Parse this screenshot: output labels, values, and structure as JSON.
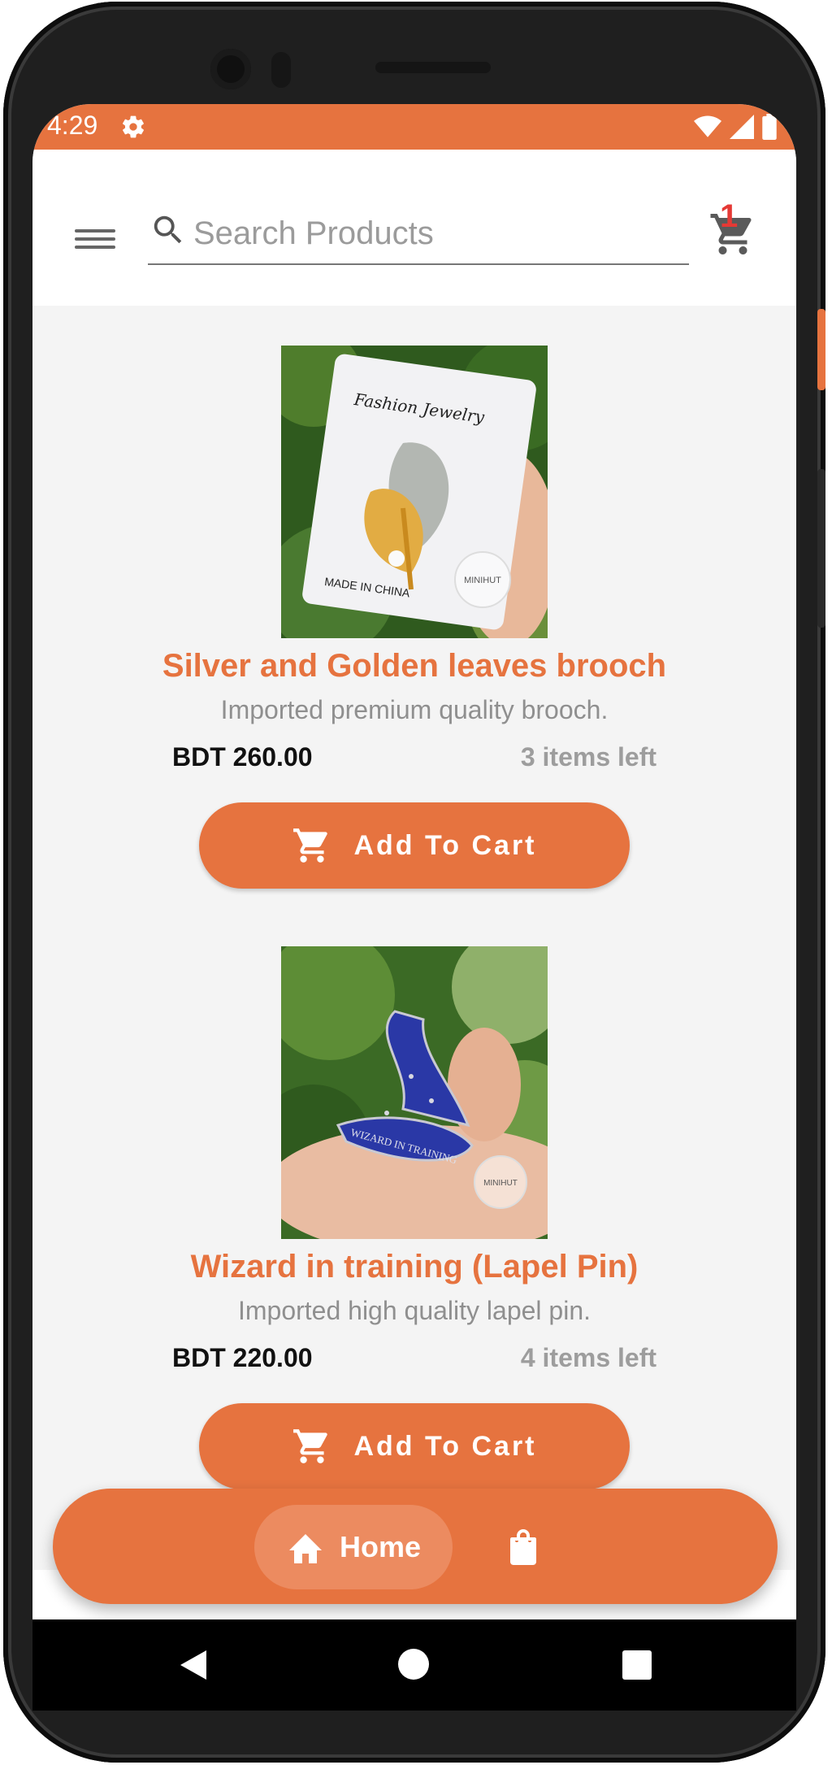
{
  "status_bar": {
    "time": "4:29",
    "icons": [
      "gear-icon",
      "wifi-icon",
      "signal-icon",
      "battery-icon"
    ],
    "background": "#e6733f"
  },
  "header": {
    "menu_icon": "hamburger-menu-icon",
    "search": {
      "placeholder": "Search Products",
      "value": ""
    },
    "cart": {
      "icon": "shopping-cart-icon",
      "count": "1"
    }
  },
  "products": [
    {
      "title": "Silver and Golden leaves brooch",
      "description": "Imported premium quality brooch.",
      "price": "BDT 260.00",
      "stock": "3 items left",
      "button_label": "Add To Cart",
      "image": {
        "card_text": "Fashion Jewelry",
        "footer_text": "MADE IN CHINA",
        "watermark": "MINIHUT"
      }
    },
    {
      "title": "Wizard in training (Lapel Pin)",
      "description": "Imported high quality lapel pin.",
      "price": "BDT 220.00",
      "stock": "4 items left",
      "button_label": "Add To Cart",
      "image": {
        "pin_text": "WIZARD IN TRAINING",
        "watermark": "MINIHUT"
      }
    }
  ],
  "bottom_nav": {
    "home_label": "Home",
    "items": [
      "home-icon",
      "shopping-bag-icon"
    ]
  },
  "system_nav": [
    "back-icon",
    "home-circle-icon",
    "recents-icon"
  ],
  "colors": {
    "accent": "#e6733f",
    "price": "#111111",
    "stock": "#9d9d9d",
    "description": "#8f8f8f",
    "badge": "#e53935"
  }
}
